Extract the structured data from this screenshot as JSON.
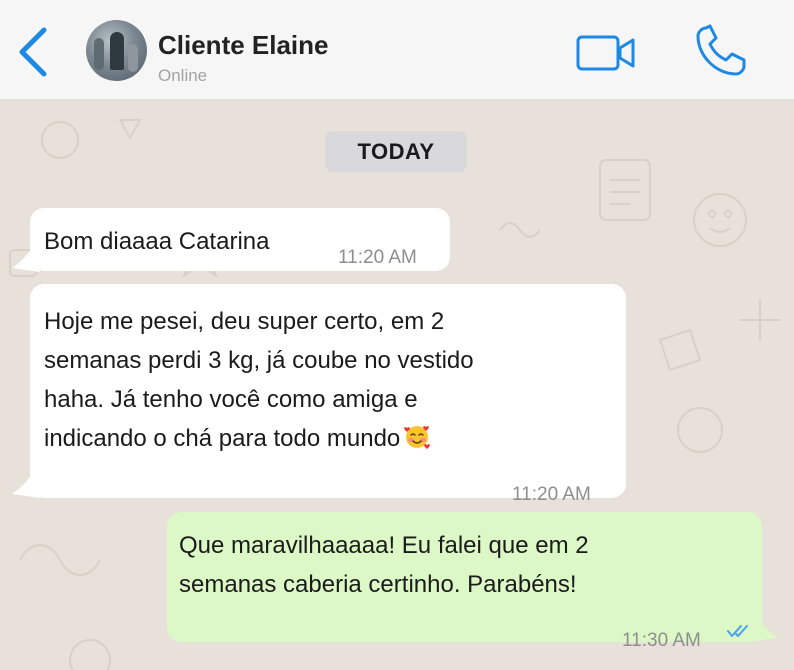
{
  "header": {
    "contact_name": "Cliente Elaine",
    "status": "Online",
    "back_icon": "chevron-left-icon",
    "video_icon": "video-camera-icon",
    "call_icon": "phone-icon"
  },
  "chat": {
    "date_label": "TODAY",
    "messages": [
      {
        "direction": "incoming",
        "text": "Bom diaaaa Catarina",
        "time": "11:20 AM"
      },
      {
        "direction": "incoming",
        "lines": [
          "Hoje me pesei, deu super certo, em 2",
          "semanas perdi 3 kg, já coube no vestido",
          "haha. Já tenho você como amiga e",
          "indicando o chá para todo mundo"
        ],
        "emoji": "smiling-face-with-hearts-icon",
        "time": "11:20 AM"
      },
      {
        "direction": "outgoing",
        "lines": [
          "Que maravilhaaaaa! Eu falei que em 2",
          "semanas caberia certinho. Parabéns!"
        ],
        "time": "11:30 AM",
        "status_icon": "double-check-read-icon"
      }
    ]
  },
  "colors": {
    "accent": "#1e88e5",
    "header_bg": "#f6f6f6",
    "wallpaper": "#e7e1d9",
    "incoming_bubble": "#ffffff",
    "outgoing_bubble": "#dcf8c6",
    "date_chip": "#d9d9dc"
  }
}
